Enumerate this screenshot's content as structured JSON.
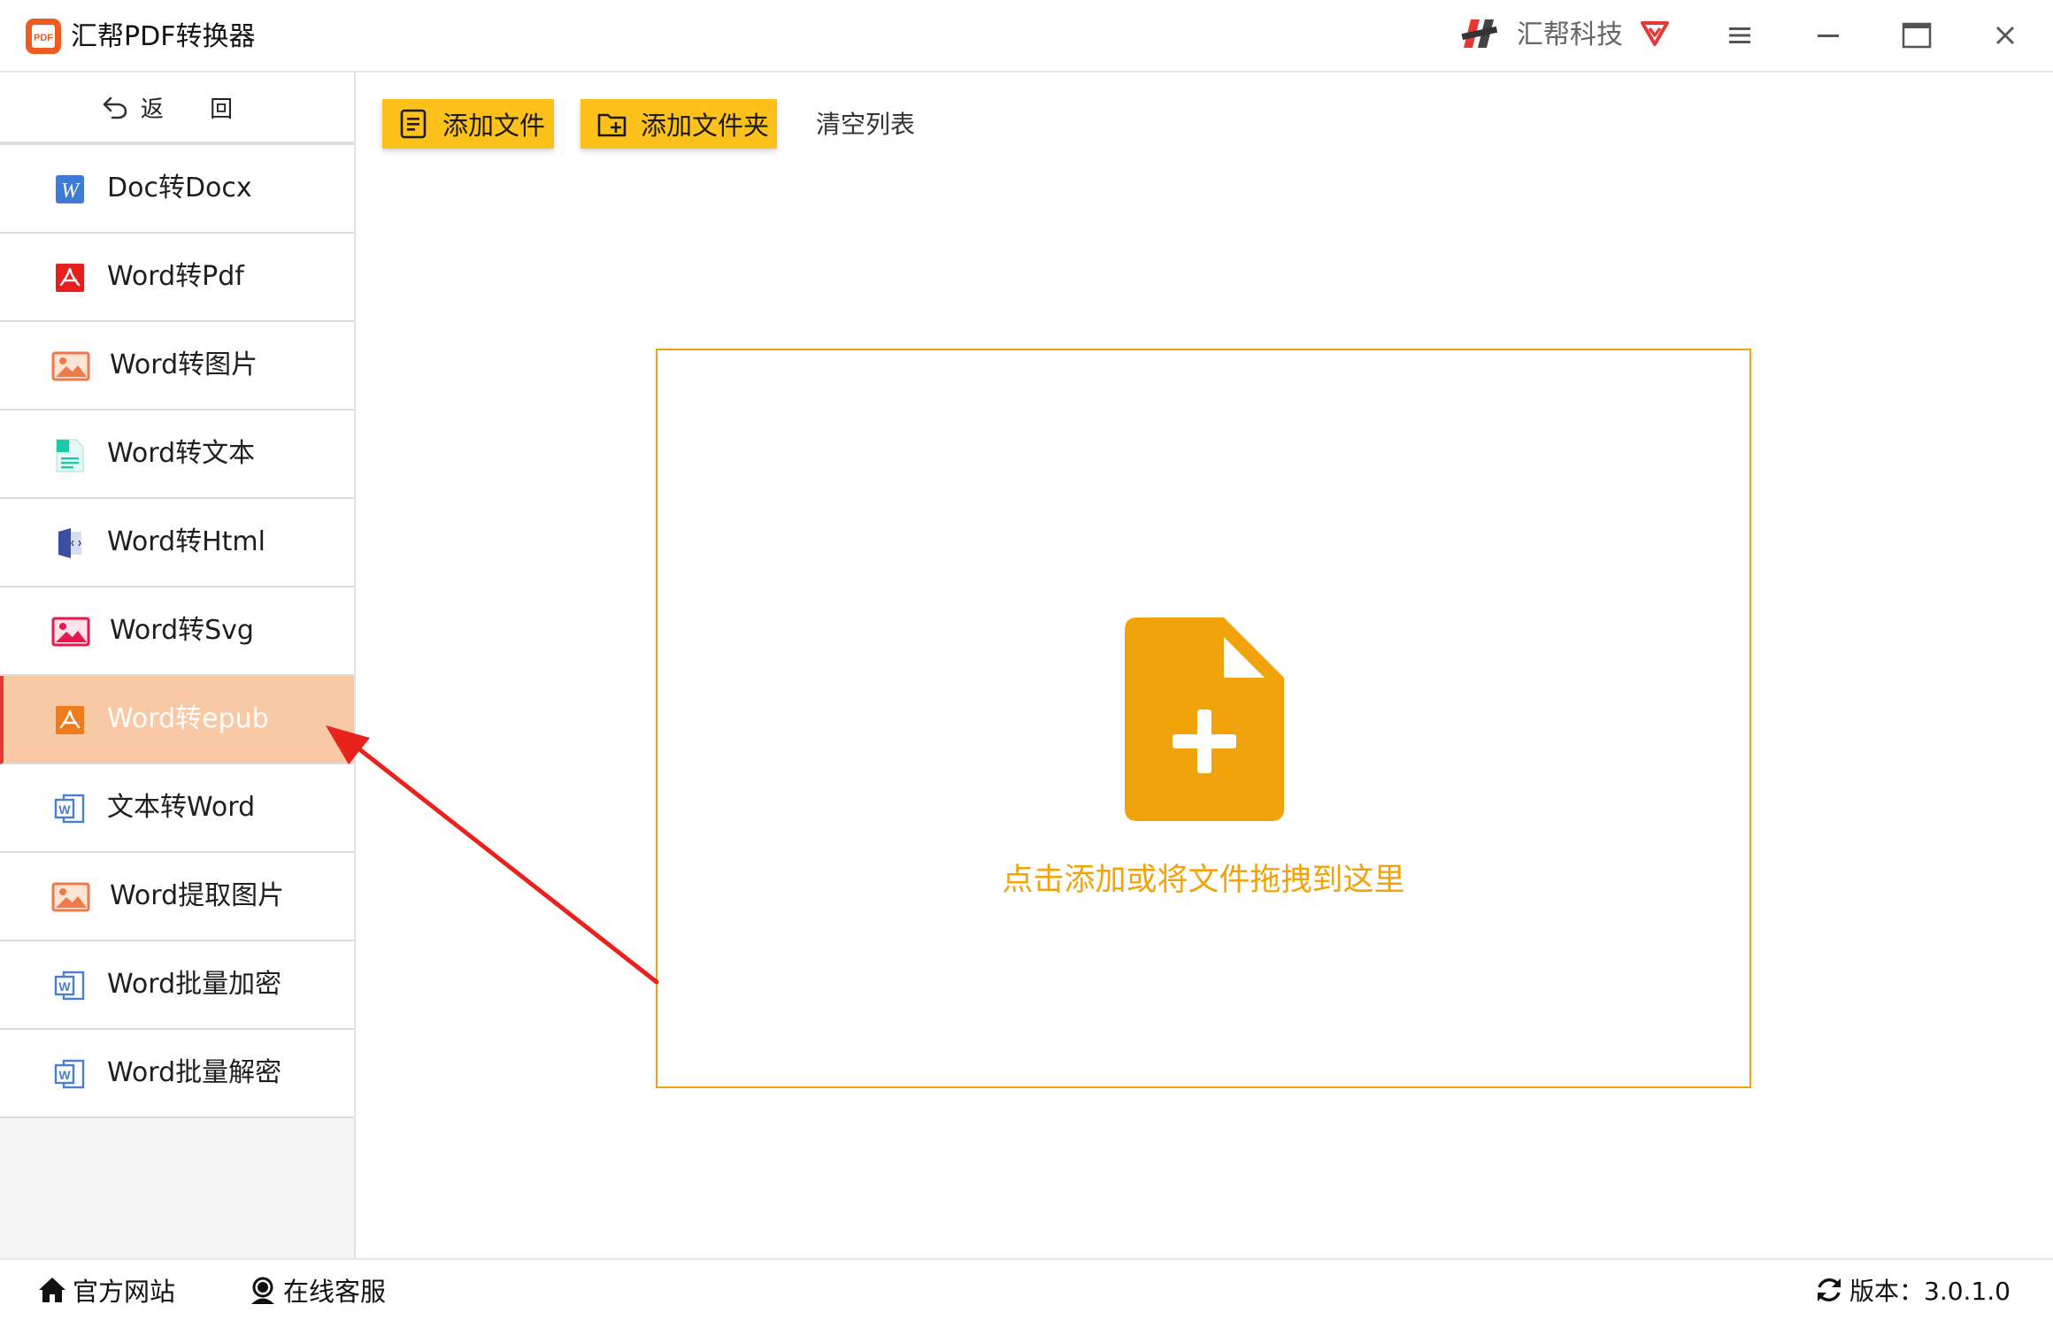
{
  "app": {
    "title": "汇帮PDF转换器",
    "logo_text": "PDF",
    "brand_name": "汇帮科技"
  },
  "window_controls": {
    "menu_icon": "hamburger-menu-icon",
    "minimize_icon": "minimize-icon",
    "maximize_icon": "maximize-icon",
    "close_icon": "close-icon"
  },
  "sidebar": {
    "back_label": "返 回",
    "items": [
      {
        "label": "Doc转Docx",
        "icon": "word-doc-icon",
        "active": false
      },
      {
        "label": "Word转Pdf",
        "icon": "pdf-icon",
        "active": false
      },
      {
        "label": "Word转图片",
        "icon": "image-icon",
        "active": false
      },
      {
        "label": "Word转文本",
        "icon": "text-file-icon",
        "active": false
      },
      {
        "label": "Word转Html",
        "icon": "html-book-icon",
        "active": false
      },
      {
        "label": "Word转Svg",
        "icon": "svg-image-icon",
        "active": false
      },
      {
        "label": "Word转epub",
        "icon": "epub-icon",
        "active": true
      },
      {
        "label": "文本转Word",
        "icon": "word-icon",
        "active": false
      },
      {
        "label": "Word提取图片",
        "icon": "image-icon",
        "active": false
      },
      {
        "label": "Word批量加密",
        "icon": "word-icon",
        "active": false
      },
      {
        "label": "Word批量解密",
        "icon": "word-icon",
        "active": false
      }
    ]
  },
  "toolbar": {
    "add_file_label": "添加文件",
    "add_folder_label": "添加文件夹",
    "clear_list_label": "清空列表"
  },
  "dropzone": {
    "hint": "点击添加或将文件拖拽到这里",
    "icon": "add-file-icon"
  },
  "statusbar": {
    "website_label": "官方网站",
    "support_label": "在线客服",
    "version_label": "版本：3.0.1.0"
  },
  "colors": {
    "accent": "#f0a30a",
    "button_yellow": "#fcc21b",
    "active_item_bg": "#f8c9a4",
    "active_marker": "#e53935",
    "arrow": "#e8231e"
  }
}
